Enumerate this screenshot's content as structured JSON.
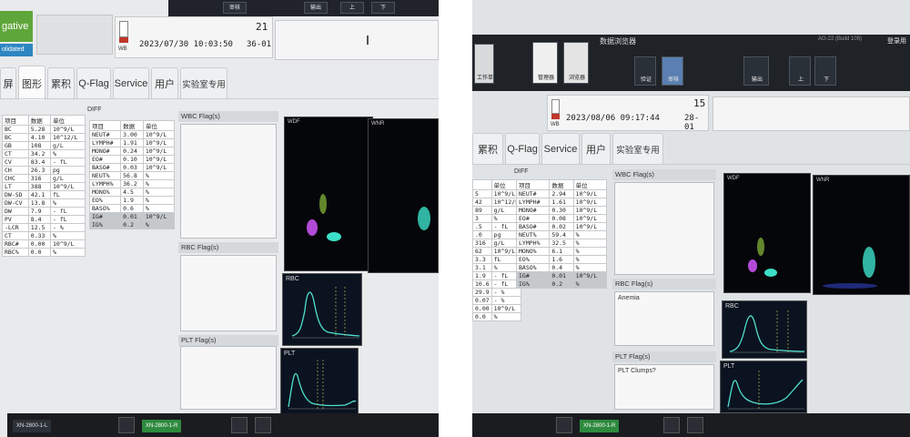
{
  "left": {
    "status": {
      "negative": "gative",
      "validated": "olidated"
    },
    "toolbar": {
      "btn1": "审核",
      "btn2": "输出",
      "btn3": "上",
      "btn4": "下"
    },
    "sample": {
      "rack": "21",
      "datetime": "2023/07/30 10:03:50",
      "pos": "36-01",
      "tube": "WB"
    },
    "tabs": [
      "屏",
      "图形",
      "累积",
      "Q-Flag",
      "Service",
      "用户",
      "实验室专用"
    ],
    "main_table": {
      "headers": [
        "项目",
        "数据",
        "单位"
      ],
      "rows": [
        [
          "BC",
          "5.28",
          "10^9/L"
        ],
        [
          "BC",
          "4.10",
          "10^12/L"
        ],
        [
          "GB",
          "108",
          "g/L"
        ],
        [
          "CT",
          "34.2",
          "%"
        ],
        [
          "CV",
          "83.4",
          "- fL"
        ],
        [
          "CH",
          "26.3",
          "pg"
        ],
        [
          "CHC",
          "316",
          "g/L"
        ],
        [
          "LT",
          "388",
          "10^9/L"
        ],
        [
          "DW-SD",
          "42.1",
          "fL"
        ],
        [
          "DW-CV",
          "13.8",
          "%"
        ],
        [
          "DW",
          "7.9",
          "- fL"
        ],
        [
          "PV",
          "8.4",
          "- fL"
        ],
        [
          "-LCR",
          "12.5",
          "- %"
        ],
        [
          "CT",
          "0.33",
          "%"
        ],
        [
          "RBC#",
          "0.00",
          "10^9/L"
        ],
        [
          "RBC%",
          "0.0",
          "%"
        ]
      ]
    },
    "diff": {
      "title": "DIFF",
      "headers": [
        "项目",
        "数据",
        "单位"
      ],
      "rows": [
        [
          "NEUT#",
          "3.00",
          "10^9/L"
        ],
        [
          "LYMPH#",
          "1.91",
          "10^9/L"
        ],
        [
          "MONO#",
          "0.24",
          "10^9/L"
        ],
        [
          "EO#",
          "0.10",
          "10^9/L"
        ],
        [
          "BASO#",
          "0.03",
          "10^9/L"
        ],
        [
          "NEUT%",
          "56.8",
          "%"
        ],
        [
          "LYMPH%",
          "36.2",
          "%"
        ],
        [
          "MONO%",
          "4.5",
          "%"
        ],
        [
          "EO%",
          "1.9",
          "%"
        ],
        [
          "BASO%",
          "0.6",
          "%"
        ],
        [
          "IG#",
          "0.01",
          "10^9/L"
        ],
        [
          "IG%",
          "0.2",
          "%"
        ]
      ]
    },
    "flags": {
      "wbc": "WBC Flag(s)",
      "rbc": "RBC Flag(s)",
      "plt": "PLT Flag(s)"
    },
    "plots": {
      "wdf": "WDF",
      "wnr": "WNR",
      "rbc": "RBC",
      "plt": "PLT"
    },
    "analyzers": [
      "XN-2800-1-L",
      "XN-2800-1-R"
    ]
  },
  "right": {
    "toolbar": {
      "title": "数据浏览器",
      "build": "AG-22 (Build 105)",
      "login": "登录用",
      "work": "工作单",
      "manage": "管理器",
      "browser": "浏览器",
      "verify": "审核",
      "output": "输出",
      "up": "上",
      "down": "下",
      "validate": "验证"
    },
    "sample": {
      "rack": "15",
      "datetime": "2023/08/06 09:17:44",
      "pos": "28-01",
      "tube": "WB"
    },
    "tabs": [
      "累积",
      "Q-Flag",
      "Service",
      "用户",
      "实验室专用"
    ],
    "main_table": {
      "headers": [
        "单位"
      ],
      "rows": [
        [
          "5",
          "10^9/L"
        ],
        [
          "42",
          "10^12/L"
        ],
        [
          "89",
          "g/L"
        ],
        [
          "3",
          "%"
        ],
        [
          ".5",
          "- fL"
        ],
        [
          ".0",
          "pg"
        ],
        [
          "316",
          "g/L"
        ],
        [
          "62",
          "10^9/L"
        ],
        [
          "3.3",
          "fL"
        ],
        [
          "3.1",
          "%"
        ],
        [
          "1.9",
          "- fL"
        ],
        [
          "10.6",
          "- fL"
        ],
        [
          "29.9",
          "- %"
        ],
        [
          "0.07",
          "- %"
        ],
        [
          "0.00",
          "10^9/L"
        ],
        [
          "0.0",
          "%"
        ]
      ]
    },
    "diff": {
      "title": "DIFF",
      "headers": [
        "项目",
        "数据",
        "单位"
      ],
      "rows": [
        [
          "NEUT#",
          "2.94",
          "10^9/L"
        ],
        [
          "LYMPH#",
          "1.61",
          "10^9/L"
        ],
        [
          "MONO#",
          "0.30",
          "10^9/L"
        ],
        [
          "EO#",
          "0.08",
          "10^9/L"
        ],
        [
          "BASO#",
          "0.02",
          "10^9/L"
        ],
        [
          "NEUT%",
          "59.4",
          "%"
        ],
        [
          "LYMPH%",
          "32.5",
          "%"
        ],
        [
          "MONO%",
          "6.1",
          "%"
        ],
        [
          "EO%",
          "1.6",
          "%"
        ],
        [
          "BASO%",
          "0.4",
          "%"
        ],
        [
          "IG#",
          "0.01",
          "10^9/L"
        ],
        [
          "IG%",
          "0.2",
          "%"
        ]
      ]
    },
    "flags": {
      "wbc": "WBC Flag(s)",
      "rbc": "RBC Flag(s)",
      "rbc_msg": "Anemia",
      "plt": "PLT Flag(s)",
      "plt_msg": "PLT Clumps?"
    },
    "plots": {
      "wdf": "WDF",
      "wnr": "WNR",
      "rbc": "RBC",
      "plt": "PLT"
    },
    "analyzers": [
      "XN-2800-1-R"
    ]
  }
}
